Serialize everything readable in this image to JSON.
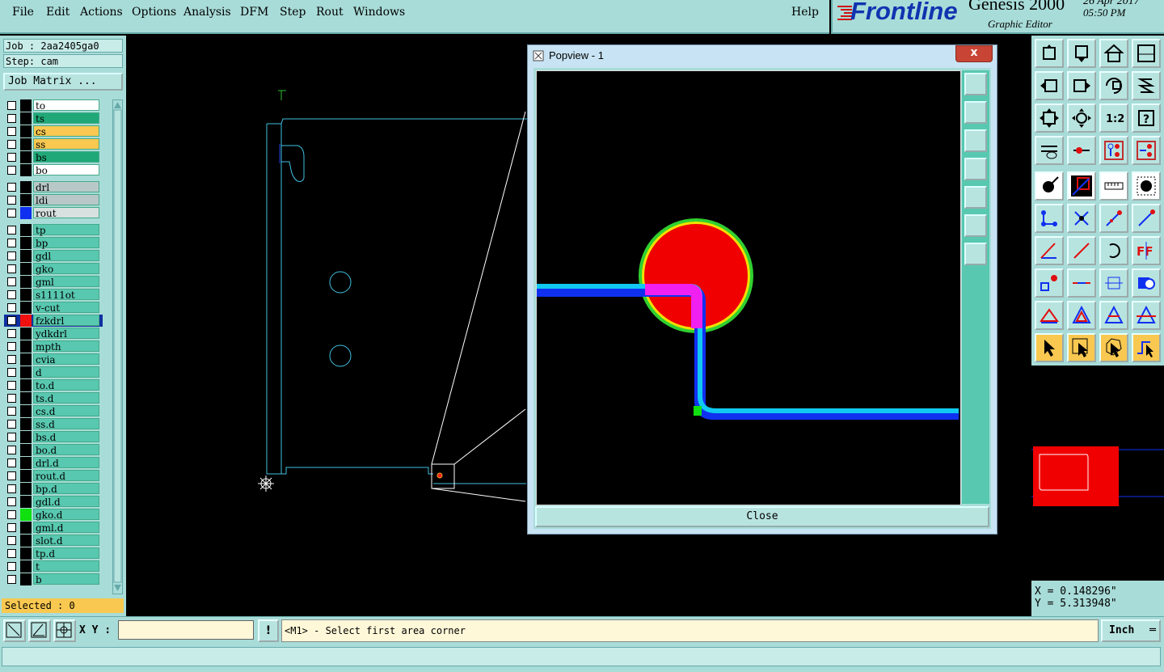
{
  "menu": {
    "items": [
      "File",
      "Edit",
      "Actions",
      "Options",
      "Analysis",
      "DFM",
      "Step",
      "Rout",
      "Windows"
    ],
    "help": "Help"
  },
  "brand": {
    "logo": "Frontline",
    "product": "Genesis 2000",
    "subtitle": "Graphic Editor",
    "date": "26 Apr 2017",
    "time": "05:50 PM"
  },
  "left": {
    "job": "Job : 2aa2405ga0",
    "step": "Step: cam",
    "job_matrix": "Job Matrix ...",
    "layers": [
      {
        "name": "to",
        "bg": "#ffffff",
        "chip": "#000000"
      },
      {
        "name": "ts",
        "bg": "#20a878",
        "chip": "#000000"
      },
      {
        "name": "cs",
        "bg": "#f8c850",
        "chip": "#000000"
      },
      {
        "name": "ss",
        "bg": "#f8c850",
        "chip": "#000000"
      },
      {
        "name": "bs",
        "bg": "#20a878",
        "chip": "#000000"
      },
      {
        "name": "bo",
        "bg": "#ffffff",
        "chip": "#000000"
      },
      {
        "name": "drl",
        "bg": "#b8c8c8",
        "chip": "#000000"
      },
      {
        "name": "ldi",
        "bg": "#b8c8c8",
        "chip": "#000000"
      },
      {
        "name": "rout",
        "bg": "#d8e0e0",
        "chip": "#1030f0"
      },
      {
        "name": "tp",
        "bg": "#58c8b0",
        "chip": "#000000"
      },
      {
        "name": "bp",
        "bg": "#58c8b0",
        "chip": "#000000"
      },
      {
        "name": "gdl",
        "bg": "#58c8b0",
        "chip": "#000000"
      },
      {
        "name": "gko",
        "bg": "#58c8b0",
        "chip": "#000000"
      },
      {
        "name": "gml",
        "bg": "#58c8b0",
        "chip": "#000000"
      },
      {
        "name": "s1111ot",
        "bg": "#58c8b0",
        "chip": "#000000"
      },
      {
        "name": "v-cut",
        "bg": "#58c8b0",
        "chip": "#000000"
      },
      {
        "name": "fzkdrl",
        "bg": "#58c8b0",
        "chip": "#f01010",
        "cb_dark": true
      },
      {
        "name": "ydkdrl",
        "bg": "#58c8b0",
        "chip": "#000000"
      },
      {
        "name": "mpth",
        "bg": "#58c8b0",
        "chip": "#000000"
      },
      {
        "name": "cvia",
        "bg": "#58c8b0",
        "chip": "#000000"
      },
      {
        "name": "d",
        "bg": "#58c8b0",
        "chip": "#000000"
      },
      {
        "name": "to.d",
        "bg": "#58c8b0",
        "chip": "#000000"
      },
      {
        "name": "ts.d",
        "bg": "#58c8b0",
        "chip": "#000000"
      },
      {
        "name": "cs.d",
        "bg": "#58c8b0",
        "chip": "#000000"
      },
      {
        "name": "ss.d",
        "bg": "#58c8b0",
        "chip": "#000000"
      },
      {
        "name": "bs.d",
        "bg": "#58c8b0",
        "chip": "#000000"
      },
      {
        "name": "bo.d",
        "bg": "#58c8b0",
        "chip": "#000000"
      },
      {
        "name": "drl.d",
        "bg": "#58c8b0",
        "chip": "#000000"
      },
      {
        "name": "rout.d",
        "bg": "#58c8b0",
        "chip": "#000000"
      },
      {
        "name": "bp.d",
        "bg": "#58c8b0",
        "chip": "#000000"
      },
      {
        "name": "gdl.d",
        "bg": "#58c8b0",
        "chip": "#000000"
      },
      {
        "name": "gko.d",
        "bg": "#58c8b0",
        "chip": "#10e010"
      },
      {
        "name": "gml.d",
        "bg": "#58c8b0",
        "chip": "#000000"
      },
      {
        "name": "slot.d",
        "bg": "#58c8b0",
        "chip": "#000000"
      },
      {
        "name": "tp.d",
        "bg": "#58c8b0",
        "chip": "#000000"
      },
      {
        "name": "t",
        "bg": "#58c8b0",
        "chip": "#000000"
      },
      {
        "name": "b",
        "bg": "#58c8b0",
        "chip": "#000000"
      }
    ],
    "selected": "Selected : 0"
  },
  "popview": {
    "title": "Popview - 1",
    "close_x": "x",
    "close_button": "Close"
  },
  "coords": {
    "x": "X = 0.148296\"",
    "y": "Y = 5.313948\""
  },
  "bottom": {
    "xy_label": "X Y :",
    "xy_value": "",
    "bang": "!",
    "prompt": "<M1> - Select first area corner",
    "units": "Inch"
  },
  "status": {
    "text": ""
  }
}
